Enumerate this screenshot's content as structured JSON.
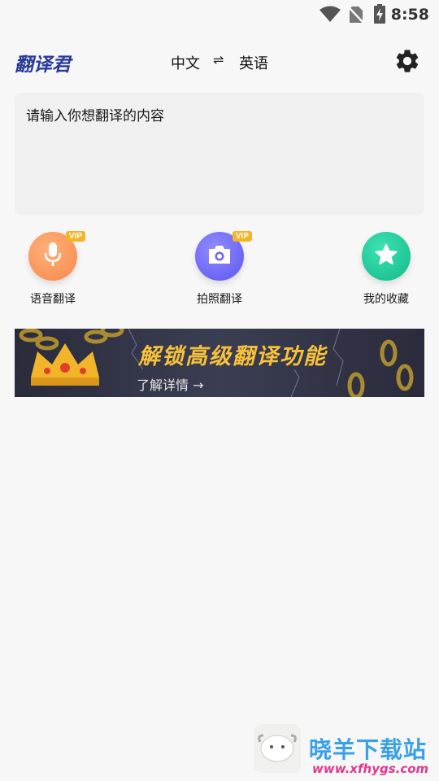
{
  "status_bar": {
    "time": "8:58",
    "icons": [
      "wifi-icon",
      "no-sim-icon",
      "battery-charging-icon"
    ]
  },
  "header": {
    "app_name": "翻译君",
    "source_lang": "中文",
    "swap_symbol": "⇌",
    "target_lang": "英语",
    "settings_icon": "gear-icon"
  },
  "input": {
    "placeholder": "请输入你想翻译的内容",
    "value": ""
  },
  "features": [
    {
      "label": "语音翻译",
      "icon": "microphone-icon",
      "badge": "VIP"
    },
    {
      "label": "拍照翻译",
      "icon": "camera-icon",
      "badge": "VIP"
    },
    {
      "label": "我的收藏",
      "icon": "star-icon",
      "badge": ""
    }
  ],
  "banner": {
    "title": "解锁高级翻译功能",
    "link_text": "了解详情 →"
  },
  "watermark": {
    "name": "晓羊下载站",
    "url": "www.xfhygs.com"
  },
  "colors": {
    "brand": "#283a9a",
    "voice": "#f6884a",
    "photo": "#5d56f0",
    "favorite": "#12b98a",
    "vip": "#f5b428",
    "banner_text": "#f7c23a"
  }
}
